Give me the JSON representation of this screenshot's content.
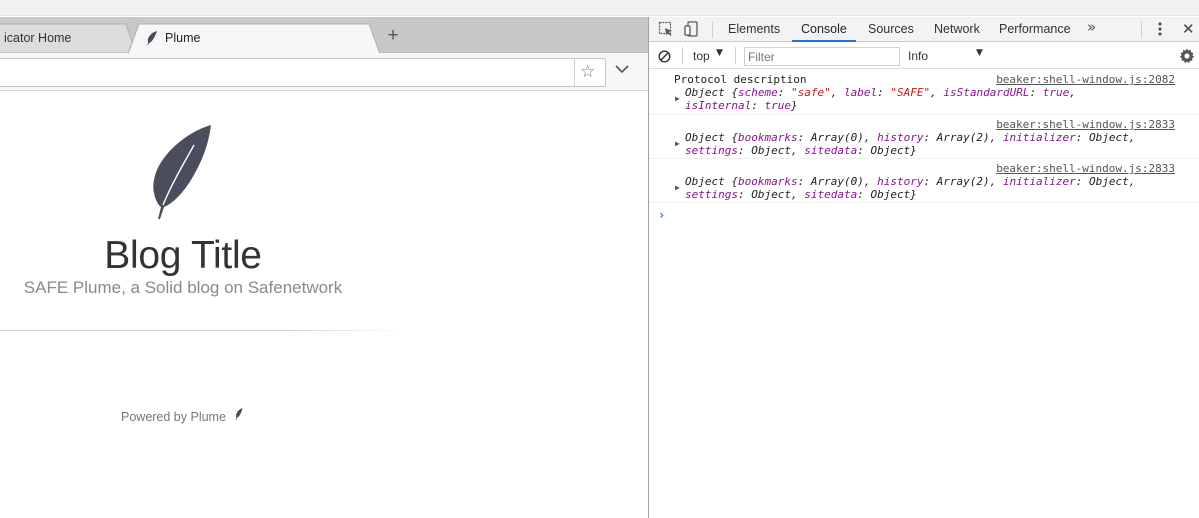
{
  "browser": {
    "tabs": [
      {
        "label": "icator Home",
        "active": false
      },
      {
        "label": "Plume",
        "active": true
      }
    ],
    "new_tab_label": "+",
    "url_value": "",
    "bookmark_glyph": "☆",
    "page": {
      "blog_title": "Blog Title",
      "blog_subtitle": "SAFE Plume, a Solid blog on Safenetwork",
      "footer": "Powered by Plume"
    }
  },
  "devtools": {
    "tabs": [
      "Elements",
      "Console",
      "Sources",
      "Network",
      "Performance"
    ],
    "active_tab": "Console",
    "more_glyph": "»",
    "close_glyph": "✕",
    "console_toolbar": {
      "context": "top",
      "filter_placeholder": "Filter",
      "level": "Info",
      "arrow": "▼"
    },
    "messages": [
      {
        "text": "Protocol description",
        "source": "beaker:shell-window.js:2082",
        "object_line1": [
          {
            "t": "Object {",
            "c": ""
          },
          {
            "t": "scheme",
            "c": "k"
          },
          {
            "t": ": ",
            "c": ""
          },
          {
            "t": "\"safe\"",
            "c": "s"
          },
          {
            "t": ", ",
            "c": ""
          },
          {
            "t": "label",
            "c": "k"
          },
          {
            "t": ": ",
            "c": ""
          },
          {
            "t": "\"SAFE\"",
            "c": "s"
          },
          {
            "t": ", ",
            "c": ""
          },
          {
            "t": "isStandardURL",
            "c": "k"
          },
          {
            "t": ": ",
            "c": ""
          },
          {
            "t": "true",
            "c": "b"
          },
          {
            "t": ",",
            "c": ""
          }
        ],
        "object_line2": [
          {
            "t": "isInternal",
            "c": "k"
          },
          {
            "t": ": ",
            "c": ""
          },
          {
            "t": "true",
            "c": "b"
          },
          {
            "t": "}",
            "c": ""
          }
        ]
      },
      {
        "text": "",
        "source": "beaker:shell-window.js:2833",
        "object_line1": [
          {
            "t": "Object {",
            "c": ""
          },
          {
            "t": "bookmarks",
            "c": "k"
          },
          {
            "t": ": Array(0), ",
            "c": ""
          },
          {
            "t": "history",
            "c": "k"
          },
          {
            "t": ": Array(2), ",
            "c": ""
          },
          {
            "t": "initializer",
            "c": "k"
          },
          {
            "t": ": Object,",
            "c": ""
          }
        ],
        "object_line2": [
          {
            "t": "settings",
            "c": "k"
          },
          {
            "t": ": Object, ",
            "c": ""
          },
          {
            "t": "sitedata",
            "c": "k"
          },
          {
            "t": ": Object}",
            "c": ""
          }
        ]
      },
      {
        "text": "",
        "source": "beaker:shell-window.js:2833",
        "object_line1": [
          {
            "t": "Object {",
            "c": ""
          },
          {
            "t": "bookmarks",
            "c": "k"
          },
          {
            "t": ": Array(0), ",
            "c": ""
          },
          {
            "t": "history",
            "c": "k"
          },
          {
            "t": ": Array(2), ",
            "c": ""
          },
          {
            "t": "initializer",
            "c": "k"
          },
          {
            "t": ": Object,",
            "c": ""
          }
        ],
        "object_line2": [
          {
            "t": "settings",
            "c": "k"
          },
          {
            "t": ": Object, ",
            "c": ""
          },
          {
            "t": "sitedata",
            "c": "k"
          },
          {
            "t": ": Object}",
            "c": ""
          }
        ]
      }
    ],
    "prompt_glyph": "›"
  },
  "colors": {
    "accent": "#1a73e8",
    "key": "#881391",
    "string": "#c41a16",
    "logo": "#4a4d5c"
  }
}
